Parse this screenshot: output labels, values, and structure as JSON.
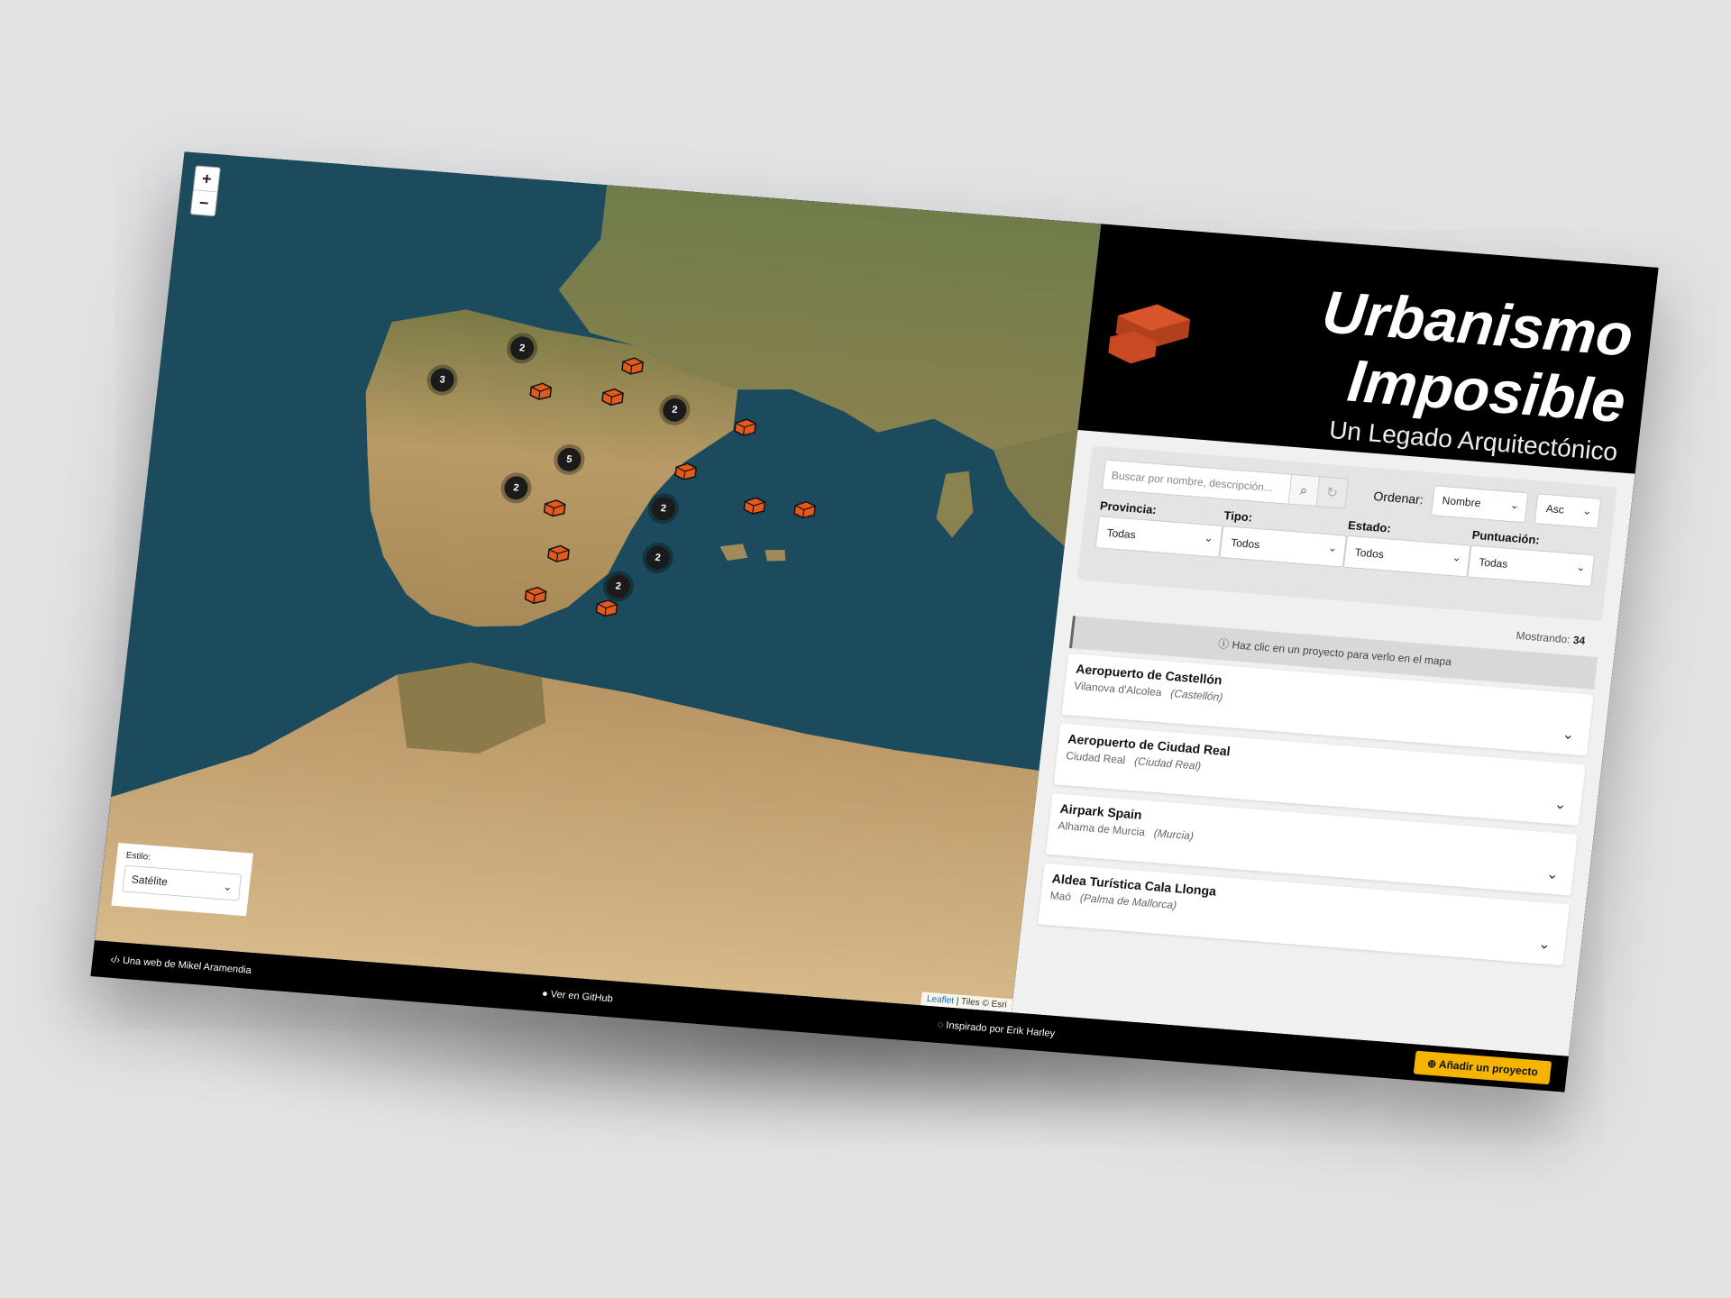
{
  "map": {
    "zoom_in": "+",
    "zoom_out": "−",
    "style_label": "Estilo:",
    "style_value": "Satélite",
    "attribution_leaflet": "Leaflet",
    "attribution_tiles": "| Tiles © Esri",
    "clusters": [
      {
        "count": "2"
      },
      {
        "count": "3"
      },
      {
        "count": "2"
      },
      {
        "count": "5"
      },
      {
        "count": "2"
      },
      {
        "count": "2"
      },
      {
        "count": "2"
      },
      {
        "count": "2"
      }
    ]
  },
  "header": {
    "title_line1": "Urbanismo",
    "title_line2": "Imposible",
    "subtitle": "Un Legado Arquitectónico"
  },
  "filters": {
    "search_placeholder": "Buscar por nombre, descripción...",
    "ordenar_label": "Ordenar:",
    "ordenar_value": "Nombre",
    "order_dir": "Asc",
    "provincia_label": "Provincia:",
    "provincia_value": "Todas",
    "tipo_label": "Tipo:",
    "tipo_value": "Todos",
    "estado_label": "Estado:",
    "estado_value": "Todos",
    "puntuacion_label": "Puntuación:",
    "puntuacion_value": "Todas",
    "mostrando_label": "Mostrando:",
    "mostrando_count": "34"
  },
  "hint": "Haz clic en un proyecto para verlo en el mapa",
  "projects": [
    {
      "name": "Aeropuerto de Castellón",
      "town": "Vilanova d'Alcolea",
      "province": "(Castellón)"
    },
    {
      "name": "Aeropuerto de Ciudad Real",
      "town": "Ciudad Real",
      "province": "(Ciudad Real)"
    },
    {
      "name": "Airpark Spain",
      "town": "Alhama de Murcia",
      "province": "(Murcia)"
    },
    {
      "name": "Aldea Turística Cala Llonga",
      "town": "Maó",
      "province": "(Palma de Mallorca)"
    }
  ],
  "footer": {
    "author": "Una web de Mikel Aramendia",
    "github": "Ver en GitHub",
    "inspired": "Inspirado por Erik Harley",
    "add_project": "Añadir un proyecto"
  }
}
